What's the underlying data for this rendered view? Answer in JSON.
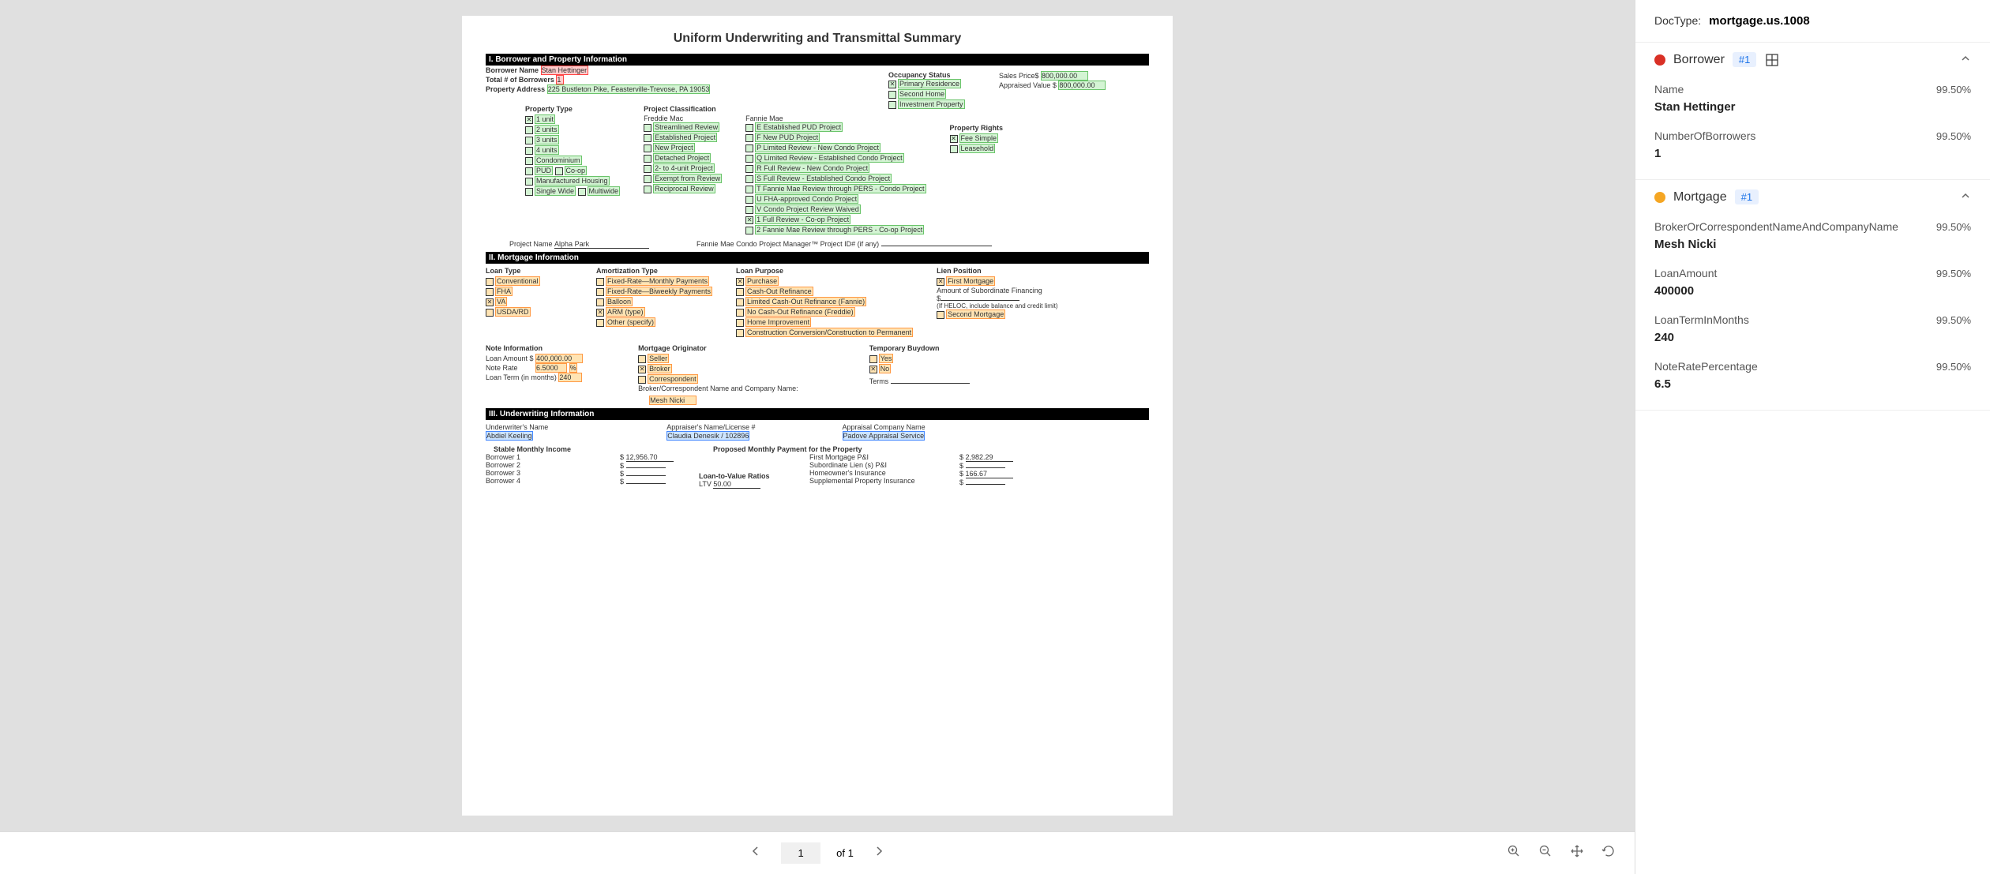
{
  "document": {
    "title": "Uniform Underwriting and Transmittal Summary",
    "sec1": {
      "header": "I. Borrower and Property Information",
      "borrower_name_label": "Borrower Name",
      "borrower_name": "Stan Hettinger",
      "total_borrowers_label": "Total # of Borrowers",
      "total_borrowers": "1",
      "property_address_label": "Property Address",
      "property_address": "225 Bustleton Pike, Feasterville-Trevose, PA 19053",
      "occupancy_label": "Occupancy Status",
      "occupancy_primary": "Primary Residence",
      "occupancy_second": "Second Home",
      "occupancy_investment": "Investment Property",
      "sales_price_label": "Sales Price$",
      "sales_price": "800,000.00",
      "appraised_label": "Appraised Value $",
      "appraised_value": "800,000.00",
      "prop_type_label": "Property Type",
      "pt_1unit": "1 unit",
      "pt_2units": "2 units",
      "pt_3units": "3 units",
      "pt_4units": "4 units",
      "pt_condo": "Condominium",
      "pt_pud": "PUD",
      "pt_coop": "Co-op",
      "pt_manufactured": "Manufactured Housing",
      "pt_single": "Single Wide",
      "pt_multi": "Multiwide",
      "proj_class_label": "Project Classification",
      "proj_freddie": "Freddie Mac",
      "pc_stream": "Streamlined Review",
      "pc_estab": "Established Project",
      "pc_new": "New Project",
      "pc_detached": "Detached Project",
      "pc_2to4": "2- to 4-unit Project",
      "pc_exempt": "Exempt from Review",
      "pc_recip": "Reciprocal Review",
      "proj_fannie": "Fannie Mae",
      "fm_e": "E Established PUD Project",
      "fm_f": "F New PUD Project",
      "fm_p": "P Limited Review - New Condo Project",
      "fm_q": "Q Limited Review - Established Condo Project",
      "fm_r": "R Full Review - New Condo Project",
      "fm_s": "S Full Review - Established Condo Project",
      "fm_t": "T Fannie Mae Review through PERS - Condo Project",
      "fm_u": "U FHA-approved Condo Project",
      "fm_v": "V Condo Project Review Waived",
      "fm_1": "1 Full Review - Co-op Project",
      "fm_2": "2 Fannie Mae Review through PERS - Co-op Project",
      "prop_rights_label": "Property Rights",
      "pr_fee": "Fee Simple",
      "pr_lease": "Leasehold",
      "project_name_label": "Project Name",
      "project_name": "Alpha Park",
      "project_id_label": "Fannie Mae Condo Project Manager™ Project ID# (if any)"
    },
    "sec2": {
      "header": "II. Mortgage Information",
      "loan_type_label": "Loan Type",
      "lt_conv": "Conventional",
      "lt_fha": "FHA",
      "lt_va": "VA",
      "lt_usda": "USDA/RD",
      "amort_label": "Amortization Type",
      "am_frm": "Fixed-Rate—Monthly Payments",
      "am_frb": "Fixed-Rate—Biweekly Payments",
      "am_balloon": "Balloon",
      "am_arm": "ARM (type)",
      "am_other": "Other (specify)",
      "loan_purpose_label": "Loan Purpose",
      "lp_purchase": "Purchase",
      "lp_cashout": "Cash-Out Refinance",
      "lp_limited": "Limited Cash-Out Refinance (Fannie)",
      "lp_nocash": "No Cash-Out Refinance (Freddie)",
      "lp_home": "Home Improvement",
      "lp_constr": "Construction Conversion/Construction to Permanent",
      "lien_label": "Lien Position",
      "lien_first": "First Mortgage",
      "lien_sub_label": "Amount of Subordinate Financing",
      "lien_dollar": "$",
      "lien_heloc": "(If HELOC, include balance and credit limit)",
      "lien_second": "Second Mortgage",
      "note_info_label": "Note Information",
      "loan_amt_label": "Loan Amount $",
      "loan_amt": "400,000.00",
      "note_rate_label": "Note Rate",
      "note_rate": "6.5000",
      "note_rate_pct": "%",
      "loan_term_label": "Loan Term (in months)",
      "loan_term": "240",
      "orig_label": "Mortgage Originator",
      "orig_seller": "Seller",
      "orig_broker": "Broker",
      "orig_corr": "Correspondent",
      "orig_company_label": "Broker/Correspondent Name and Company Name:",
      "orig_company": "Mesh Nicki",
      "buydown_label": "Temporary Buydown",
      "bd_yes": "Yes",
      "bd_no": "No",
      "terms_label": "Terms"
    },
    "sec3": {
      "header": "III. Underwriting Information",
      "uw_name_label": "Underwriter's Name",
      "uw_name": "Abdiel Keeling",
      "appr_name_label": "Appraiser's Name/License #",
      "appr_name": "Claudia Denesik / 102896",
      "appr_co_label": "Appraisal Company Name",
      "appr_co": "Padove Appraisal Service",
      "stable_label": "Stable Monthly Income",
      "proposed_label": "Proposed Monthly Payment for the Property",
      "b1": "Borrower 1",
      "b2": "Borrower 2",
      "b3": "Borrower 3",
      "b4": "Borrower 4",
      "b1_val": "12,956.70",
      "ltv_label": "Loan-to-Value Ratios",
      "ltv_sub": "LTV",
      "ltv_val": "50.00",
      "pm_first": "First Mortgage P&I",
      "pm_sub": "Subordinate Lien (s) P&I",
      "pm_home": "Homeowner's Insurance",
      "pm_supp": "Supplemental Property Insurance",
      "pm_first_val": "2,982.29",
      "pm_home_val": "166.67"
    }
  },
  "toolbar": {
    "current_page": "1",
    "page_of": "of 1"
  },
  "panel": {
    "doctype_label": "DocType:",
    "doctype_value": "mortgage.us.1008",
    "borrower": {
      "title": "Borrower",
      "badge": "#1",
      "name_label": "Name",
      "name_value": "Stan Hettinger",
      "name_conf": "99.50%",
      "num_label": "NumberOfBorrowers",
      "num_value": "1",
      "num_conf": "99.50%"
    },
    "mortgage": {
      "title": "Mortgage",
      "badge": "#1",
      "broker_label": "BrokerOrCorrespondentNameAndCompanyName",
      "broker_value": "Mesh Nicki",
      "broker_conf": "99.50%",
      "loan_label": "LoanAmount",
      "loan_value": "400000",
      "loan_conf": "99.50%",
      "term_label": "LoanTermInMonths",
      "term_value": "240",
      "term_conf": "99.50%",
      "rate_label": "NoteRatePercentage",
      "rate_value": "6.5",
      "rate_conf": "99.50%"
    }
  }
}
